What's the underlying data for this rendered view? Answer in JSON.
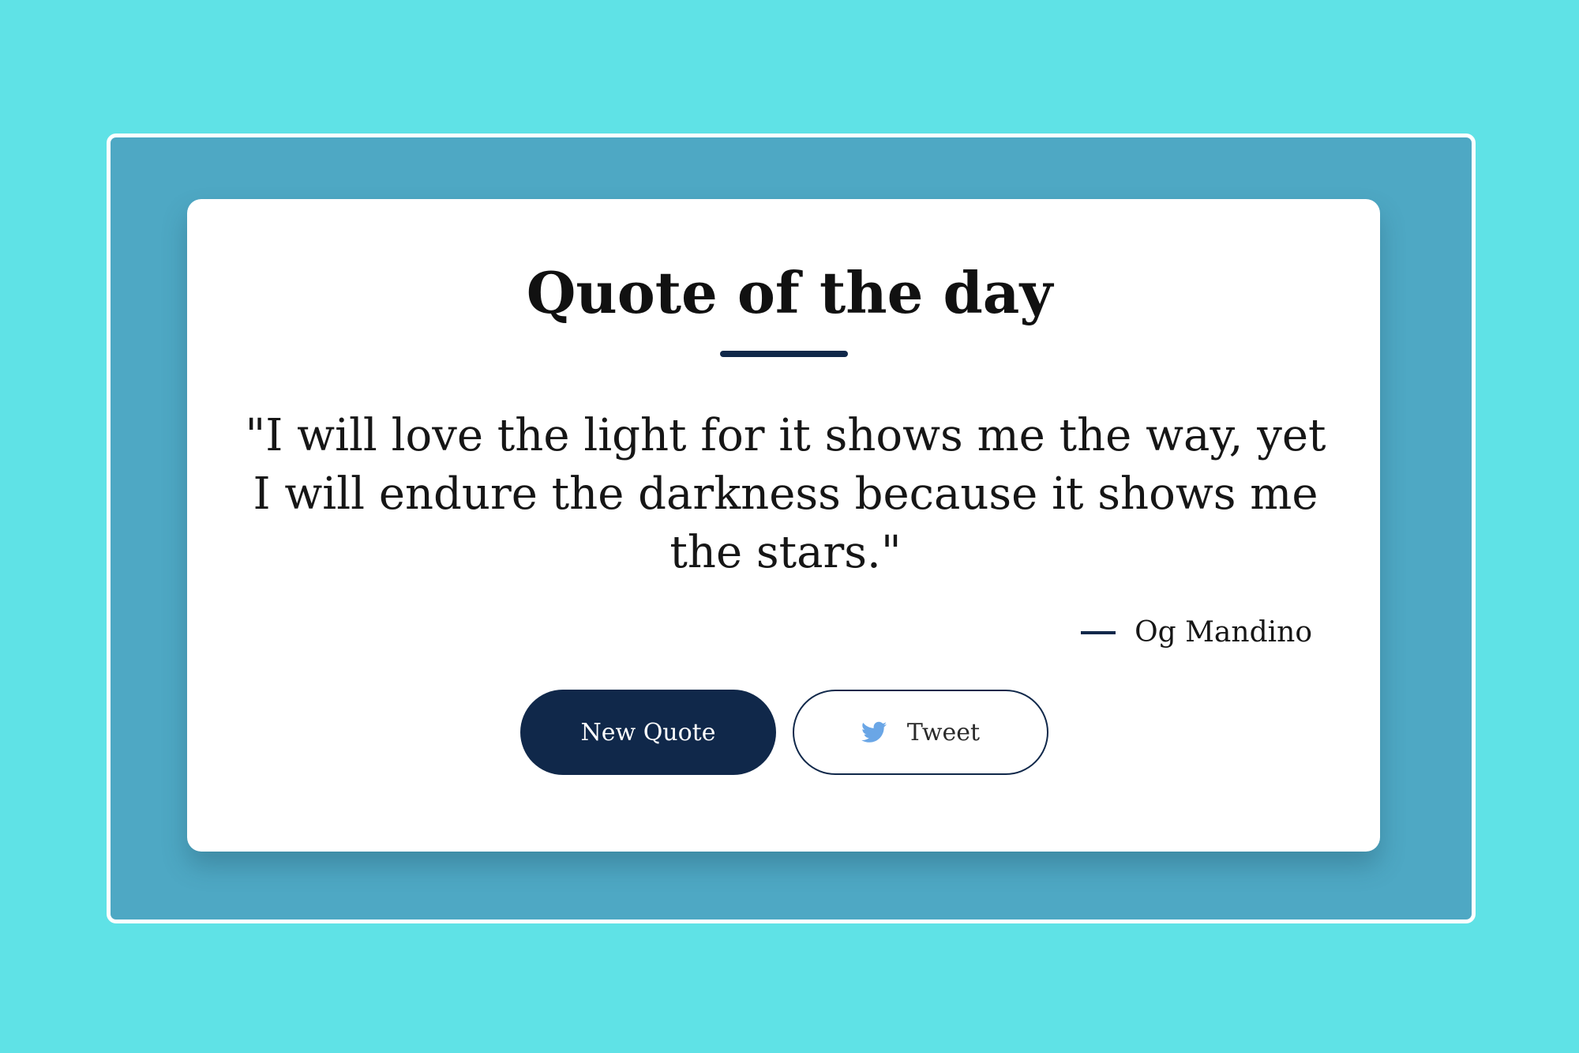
{
  "page": {
    "background_color": "#5fe2e6",
    "frame_color": "#4ea8c4",
    "accent_color": "#10284a",
    "twitter_color": "#6aa6e6"
  },
  "card": {
    "title": "Quote of the day",
    "quote": "\"I will love the light for it shows me the way, yet I will endure the darkness because it shows me the stars.\"",
    "author": "Og Mandino"
  },
  "actions": {
    "new_quote_label": "New Quote",
    "tweet_label": "Tweet",
    "tweet_icon": "twitter-bird-icon"
  }
}
